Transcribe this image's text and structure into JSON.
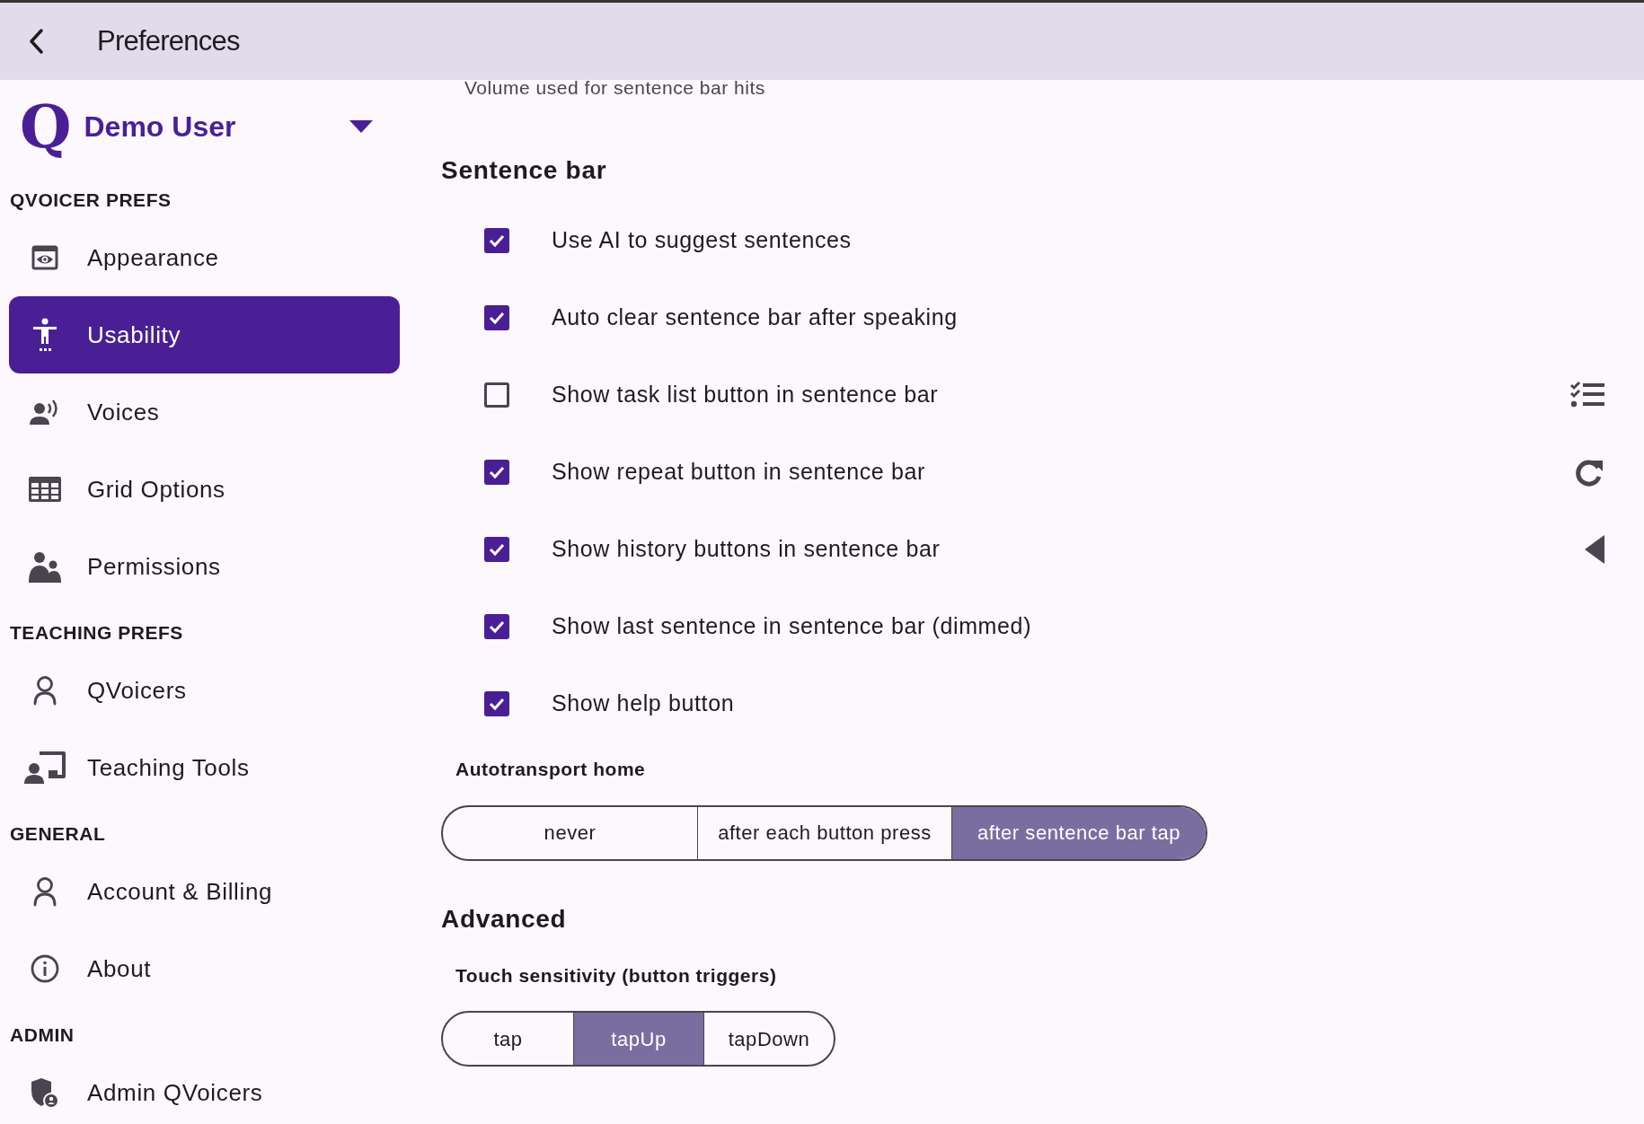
{
  "header": {
    "title": "Preferences"
  },
  "sidebar": {
    "logo": "Q",
    "user_name": "Demo User",
    "sections": [
      {
        "title": "QVOICER PREFS",
        "items": [
          {
            "label": "Appearance",
            "selected": false
          },
          {
            "label": "Usability",
            "selected": true
          },
          {
            "label": "Voices",
            "selected": false
          },
          {
            "label": "Grid Options",
            "selected": false
          },
          {
            "label": "Permissions",
            "selected": false
          }
        ]
      },
      {
        "title": "TEACHING PREFS",
        "items": [
          {
            "label": "QVoicers",
            "selected": false
          },
          {
            "label": "Teaching Tools",
            "selected": false
          }
        ]
      },
      {
        "title": "GENERAL",
        "items": [
          {
            "label": "Account & Billing",
            "selected": false
          },
          {
            "label": "About",
            "selected": false
          }
        ]
      },
      {
        "title": "ADMIN",
        "items": [
          {
            "label": "Admin QVoicers",
            "selected": false
          }
        ]
      }
    ]
  },
  "content": {
    "cut_text": "Volume used for sentence bar hits",
    "sections": [
      {
        "title": "Sentence bar",
        "settings": [
          {
            "label": "Use AI to suggest sentences",
            "checked": true
          },
          {
            "label": "Auto clear sentence bar after speaking",
            "checked": true
          },
          {
            "label": "Show task list button in sentence bar",
            "checked": false
          },
          {
            "label": "Show repeat button in sentence bar",
            "checked": true
          },
          {
            "label": "Show history buttons in sentence bar",
            "checked": true
          },
          {
            "label": "Show last sentence in sentence bar (dimmed)",
            "checked": true
          },
          {
            "label": "Show help button",
            "checked": true
          }
        ],
        "choice": {
          "label": "Autotransport home",
          "options": [
            {
              "label": "never",
              "selected": false
            },
            {
              "label": "after each button press",
              "selected": false
            },
            {
              "label": "after sentence bar tap",
              "selected": true
            }
          ]
        }
      },
      {
        "title": "Advanced",
        "choice": {
          "label": "Touch sensitivity (button triggers)",
          "options": [
            {
              "label": "tap",
              "selected": false
            },
            {
              "label": "tapUp",
              "selected": true
            },
            {
              "label": "tapDown",
              "selected": false
            }
          ]
        }
      }
    ]
  }
}
